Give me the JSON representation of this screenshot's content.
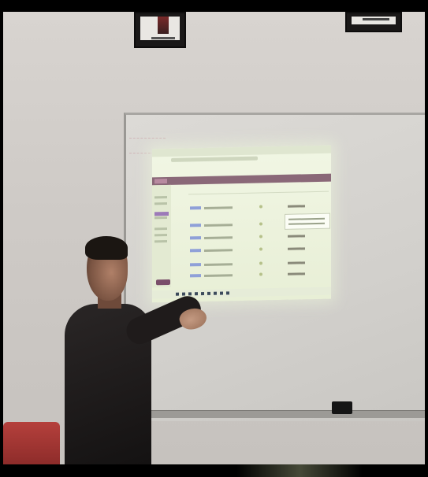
{
  "scene": {
    "type": "photo",
    "subject": "presenter",
    "colors": {
      "wall": "#d4d0cc",
      "whiteboard": "#d6d4d0",
      "projection_glow": "#eef4de",
      "app_header": "#8a6878",
      "presenter_shirt": "#1d1a1a",
      "chair": "#a0363a"
    }
  }
}
